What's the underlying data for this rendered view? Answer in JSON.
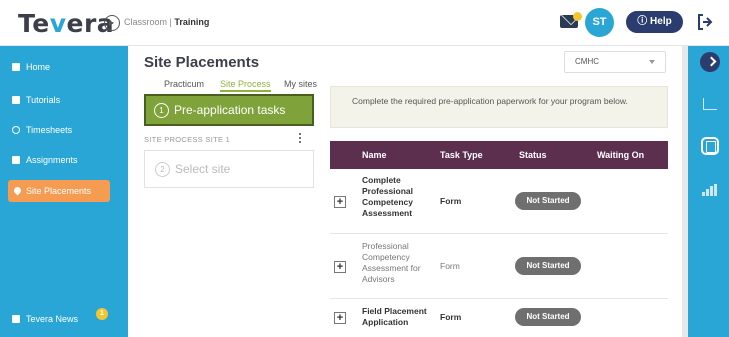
{
  "header": {
    "logo_prefix": "Te",
    "logo_v": "v",
    "logo_suffix": "era",
    "breadcrumb_root": "Classroom",
    "breadcrumb_sep": " | ",
    "breadcrumb_current": "Training",
    "avatar_initials": "ST",
    "help_label": "ⓘ Help"
  },
  "sidebar": {
    "items": [
      {
        "label": "Home",
        "icon": "grid-icon"
      },
      {
        "label": "Tutorials",
        "icon": "video-icon"
      },
      {
        "label": "Timesheets",
        "icon": "clock-icon"
      },
      {
        "label": "Assignments",
        "icon": "folder-icon"
      },
      {
        "label": "Site Placements",
        "icon": "map-pin-icon",
        "active": true
      }
    ],
    "news_label": "Tevera News",
    "news_count": "1"
  },
  "main": {
    "title": "Site Placements",
    "org_select": "CMHC",
    "tabs": [
      {
        "label": "Practicum"
      },
      {
        "label": "Site Process",
        "active": true
      },
      {
        "label": "My sites"
      }
    ],
    "step1_num": "1",
    "step1_label": "Pre-application tasks",
    "site_section_label": "SITE PROCESS SITE 1",
    "step2_num": "2",
    "step2_label": "Select site",
    "info_text": "Complete the required pre-application paperwork for your program below.",
    "table": {
      "headers": [
        "Name",
        "Task Type",
        "Status",
        "Waiting On"
      ],
      "rows": [
        {
          "name": "Complete Professional Competency Assessment",
          "type": "Form",
          "status": "Not Started",
          "waiting_on": ""
        },
        {
          "name": "Professional Competency Assessment for Advisors",
          "type": "Form",
          "status": "Not Started",
          "waiting_on": ""
        },
        {
          "name": "Field Placement Application",
          "type": "Form",
          "status": "Not Started",
          "waiting_on": ""
        }
      ]
    }
  },
  "colors": {
    "brand_blue": "#2aa6d6",
    "active_orange": "#f59c52",
    "step_green": "#7fa23a",
    "table_header": "#5c2f4e",
    "help_navy": "#2a3d6e"
  }
}
